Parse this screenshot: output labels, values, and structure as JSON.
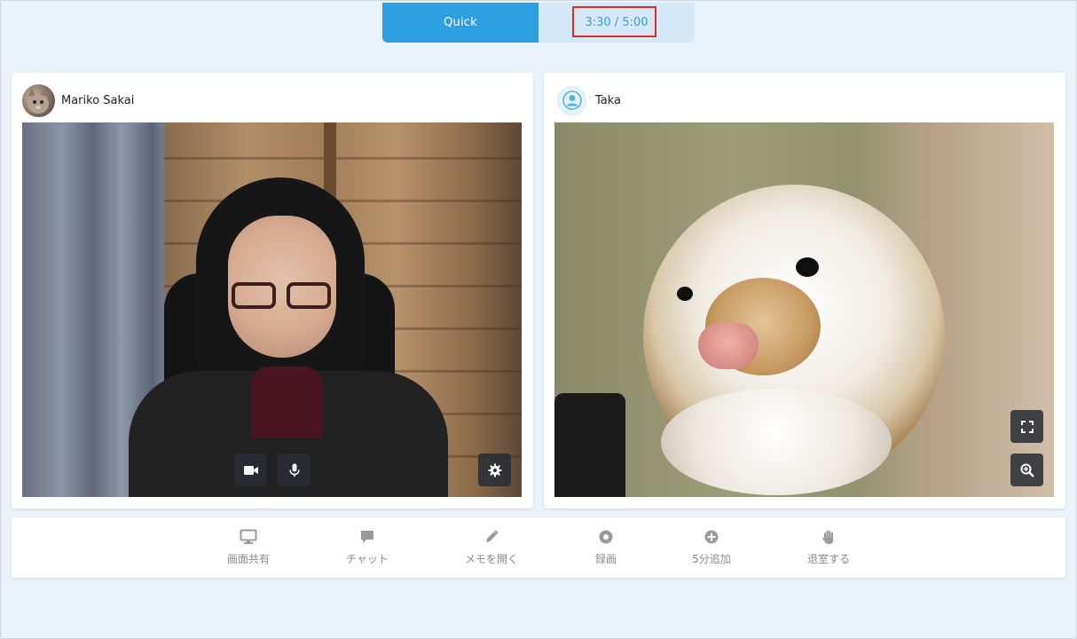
{
  "topbar": {
    "mode_label": "Quick",
    "timer_text": "3:30 / 5:00"
  },
  "participants": [
    {
      "name": "Mariko Sakai",
      "avatar": "cat-photo-avatar"
    },
    {
      "name": "Taka",
      "avatar": "default-user-avatar"
    }
  ],
  "video_controls": {
    "left": [
      "video-camera-icon",
      "microphone-icon",
      "gear-icon"
    ],
    "right": [
      "fullscreen-icon",
      "zoom-in-icon"
    ]
  },
  "toolbar": {
    "items": [
      {
        "label": "画面共有",
        "icon": "monitor-icon"
      },
      {
        "label": "チャット",
        "icon": "chat-bubble-icon"
      },
      {
        "label": "メモを開く",
        "icon": "pencil-icon"
      },
      {
        "label": "録画",
        "icon": "record-icon"
      },
      {
        "label": "5分追加",
        "icon": "plus-circle-icon"
      },
      {
        "label": "退室する",
        "icon": "hand-icon"
      }
    ]
  },
  "colors": {
    "background": "#eaf3fa",
    "accent": "#2d9fe0",
    "timer_bg": "#d4e8f7",
    "timer_text": "#3b9ad8",
    "highlight": "#e02a2a",
    "toolbar_icon": "#9a9a9a"
  }
}
